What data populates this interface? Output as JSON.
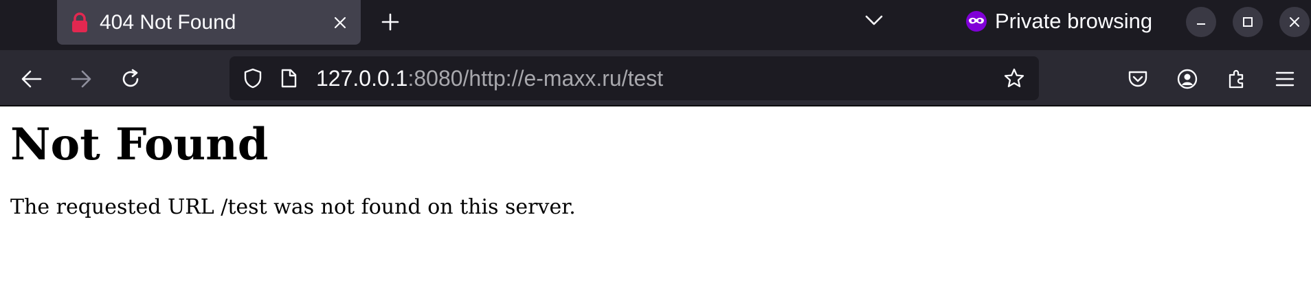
{
  "tabs": [
    {
      "title": "404 Not Found",
      "icon": "lock-icon",
      "active": true
    }
  ],
  "window": {
    "private_label": "Private browsing"
  },
  "urlbar": {
    "host": "127.0.0.1",
    "rest": ":8080/http://e-maxx.ru/test"
  },
  "page": {
    "heading": "Not Found",
    "message": "The requested URL /test was not found on this server."
  },
  "colors": {
    "tabstrip_bg": "#1c1b22",
    "active_tab_bg": "#42414d",
    "navbar_bg": "#2b2a33",
    "urlbar_bg": "#1c1b22",
    "lock_red": "#e22850",
    "private_purple": "#8000d7"
  }
}
